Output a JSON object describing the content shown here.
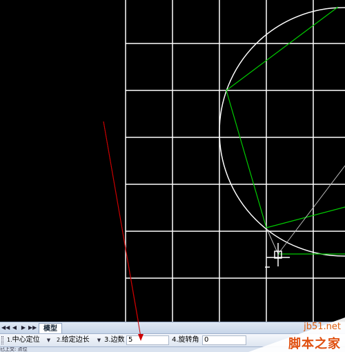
{
  "tabs": {
    "model_label": "模型",
    "nav": [
      "◀◀",
      "◀",
      "▶",
      "▶▶"
    ]
  },
  "command": {
    "opt1_num": "1.",
    "opt1_label": "中心定位",
    "opt2_num": "2.",
    "opt2_label": "给定边长",
    "opt3_label": "3.边数",
    "opt3_value": "5",
    "opt4_label": "4.旋转角",
    "opt4_value": "0"
  },
  "status": {
    "text": "已上交: 点位"
  },
  "watermark": {
    "url": "jb51.net",
    "name": "脚本之家"
  },
  "colors": {
    "grid": "#ffffff",
    "circle": "#ffffff",
    "polygon": "#00cc00",
    "arrow": "#cc0000",
    "canvas": "#000000"
  },
  "icons": {
    "dropdown": "chevron-down-icon",
    "crosshair": "crosshair-cursor-icon"
  }
}
